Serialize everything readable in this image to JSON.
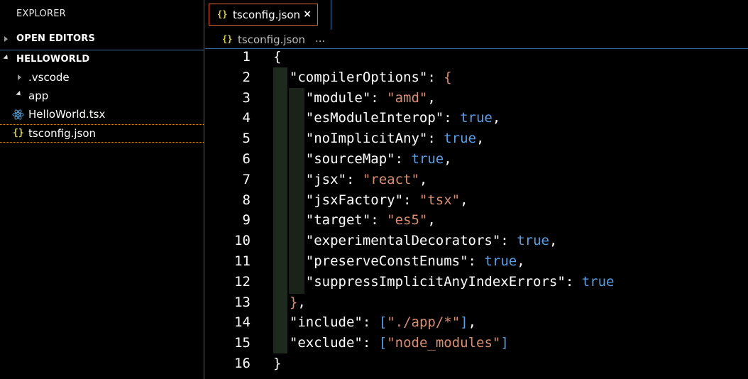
{
  "sidebar": {
    "title": "EXPLORER",
    "open_editors": "OPEN EDITORS",
    "project": "HELLOWORLD",
    "items": [
      {
        "label": ".vscode",
        "icon": "chevron-right-icon"
      },
      {
        "label": "app",
        "icon": "chevron-down-icon"
      },
      {
        "label": "HelloWorld.tsx",
        "icon": "react-icon"
      },
      {
        "label": "tsconfig.json",
        "icon": "json-icon"
      }
    ],
    "json_icon_glyph": "{}"
  },
  "tab": {
    "label": "tsconfig.json",
    "icon_glyph": "{}",
    "close_glyph": "×"
  },
  "breadcrumb": {
    "icon_glyph": "{}",
    "file": "tsconfig.json",
    "separator": "..."
  },
  "colors": {
    "background": "#000000",
    "tab_border": "#e0663a",
    "divider": "#3a6a9a",
    "string": "#d98e73",
    "boolean": "#5a9ee6",
    "json_icon": "#d4cc4a",
    "react_icon": "#5aa0d8"
  },
  "code": {
    "line_numbers": [
      "1",
      "2",
      "3",
      "4",
      "5",
      "6",
      "7",
      "8",
      "9",
      "10",
      "11",
      "12",
      "13",
      "14",
      "15",
      "16"
    ],
    "lines": [
      [
        {
          "t": "{",
          "c": "punc"
        }
      ],
      [
        {
          "t": "  \"compilerOptions\"",
          "c": "key"
        },
        {
          "t": ": ",
          "c": "punc"
        },
        {
          "t": "{",
          "c": "brace"
        }
      ],
      [
        {
          "t": "    \"module\"",
          "c": "key"
        },
        {
          "t": ": ",
          "c": "punc"
        },
        {
          "t": "\"amd\"",
          "c": "str"
        },
        {
          "t": ",",
          "c": "punc"
        }
      ],
      [
        {
          "t": "    \"esModuleInterop\"",
          "c": "key"
        },
        {
          "t": ": ",
          "c": "punc"
        },
        {
          "t": "true",
          "c": "bool"
        },
        {
          "t": ",",
          "c": "punc"
        }
      ],
      [
        {
          "t": "    \"noImplicitAny\"",
          "c": "key"
        },
        {
          "t": ": ",
          "c": "punc"
        },
        {
          "t": "true",
          "c": "bool"
        },
        {
          "t": ",",
          "c": "punc"
        }
      ],
      [
        {
          "t": "    \"sourceMap\"",
          "c": "key"
        },
        {
          "t": ": ",
          "c": "punc"
        },
        {
          "t": "true",
          "c": "bool"
        },
        {
          "t": ",",
          "c": "punc"
        }
      ],
      [
        {
          "t": "    \"jsx\"",
          "c": "key"
        },
        {
          "t": ": ",
          "c": "punc"
        },
        {
          "t": "\"react\"",
          "c": "str"
        },
        {
          "t": ",",
          "c": "punc"
        }
      ],
      [
        {
          "t": "    \"jsxFactory\"",
          "c": "key"
        },
        {
          "t": ": ",
          "c": "punc"
        },
        {
          "t": "\"tsx\"",
          "c": "str"
        },
        {
          "t": ",",
          "c": "punc"
        }
      ],
      [
        {
          "t": "    \"target\"",
          "c": "key"
        },
        {
          "t": ": ",
          "c": "punc"
        },
        {
          "t": "\"es5\"",
          "c": "str"
        },
        {
          "t": ",",
          "c": "punc"
        }
      ],
      [
        {
          "t": "    \"experimentalDecorators\"",
          "c": "key"
        },
        {
          "t": ": ",
          "c": "punc"
        },
        {
          "t": "true",
          "c": "bool"
        },
        {
          "t": ",",
          "c": "punc"
        }
      ],
      [
        {
          "t": "    \"preserveConstEnums\"",
          "c": "key"
        },
        {
          "t": ": ",
          "c": "punc"
        },
        {
          "t": "true",
          "c": "bool"
        },
        {
          "t": ",",
          "c": "punc"
        }
      ],
      [
        {
          "t": "    \"suppressImplicitAnyIndexErrors\"",
          "c": "key"
        },
        {
          "t": ": ",
          "c": "punc"
        },
        {
          "t": "true",
          "c": "bool"
        }
      ],
      [
        {
          "t": "  ",
          "c": "punc"
        },
        {
          "t": "}",
          "c": "brace"
        },
        {
          "t": ",",
          "c": "punc"
        }
      ],
      [
        {
          "t": "  \"include\"",
          "c": "key"
        },
        {
          "t": ": ",
          "c": "punc"
        },
        {
          "t": "[",
          "c": "bracket"
        },
        {
          "t": "\"./app/*\"",
          "c": "str"
        },
        {
          "t": "]",
          "c": "bracket"
        },
        {
          "t": ",",
          "c": "punc"
        }
      ],
      [
        {
          "t": "  \"exclude\"",
          "c": "key"
        },
        {
          "t": ": ",
          "c": "punc"
        },
        {
          "t": "[",
          "c": "bracket"
        },
        {
          "t": "\"node_modules\"",
          "c": "str"
        },
        {
          "t": "]",
          "c": "bracket"
        }
      ],
      [
        {
          "t": "}",
          "c": "punc"
        }
      ]
    ]
  }
}
